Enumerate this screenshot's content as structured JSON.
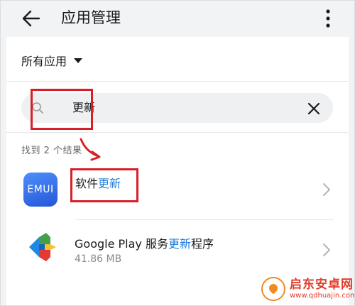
{
  "header": {
    "title": "应用管理",
    "back_icon": "arrow-left-icon",
    "more_icon": "more-vertical-icon"
  },
  "filter": {
    "label": "所有应用",
    "caret_icon": "caret-down-icon"
  },
  "search": {
    "value": "更新",
    "search_icon": "search-icon",
    "clear_icon": "close-icon"
  },
  "results": {
    "count_label": "找到 2 个结果",
    "items": [
      {
        "name_prefix": "软件",
        "name_highlight": "更新",
        "name_suffix": "",
        "size": "",
        "icon_text": "EMUI"
      },
      {
        "name_prefix": "Google Play 服务",
        "name_highlight": "更新",
        "name_suffix": "程序",
        "size": "41.86 MB",
        "icon_text": ""
      }
    ]
  },
  "watermark": {
    "name": "启东安卓网",
    "url": "www.qdhuajin.com"
  },
  "colors": {
    "accent": "#1f7bd8",
    "annotation": "#d91f26",
    "background": "#f1f3f5"
  }
}
